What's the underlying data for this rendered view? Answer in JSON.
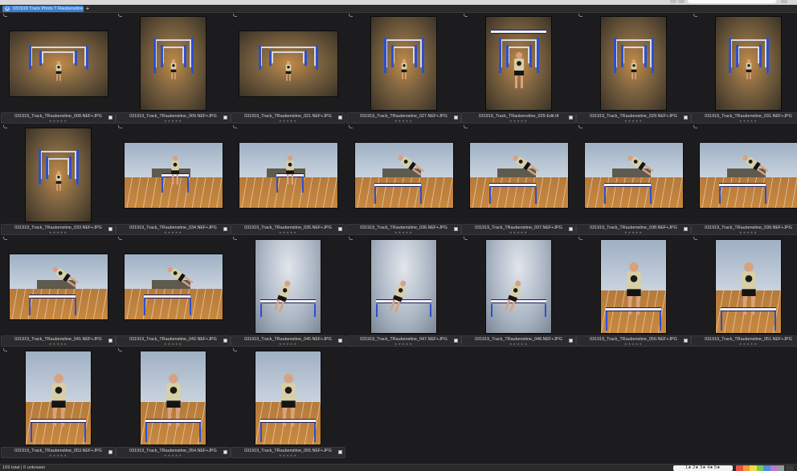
{
  "window": {
    "tab_title": "031919 Track Prints T Raubenstine",
    "tab_close_glyph": "×",
    "tab_add_glyph": "+"
  },
  "thumbnails": [
    {
      "filename": "031919_Track_TRaubenstine_008.NEF+JPG",
      "scene": "tunnel",
      "orientation": "landscape"
    },
    {
      "filename": "031919_Track_TRaubenstine_009.NEF+JPG",
      "scene": "tunnel",
      "orientation": "portrait"
    },
    {
      "filename": "031919_Track_TRaubenstine_021.NEF+JPG",
      "scene": "tunnel",
      "orientation": "landscape"
    },
    {
      "filename": "031919_Track_TRaubenstine_027.NEF+JPG",
      "scene": "tunnel",
      "orientation": "portrait"
    },
    {
      "filename": "031919_Track_TRaubenstine_029-Edit.tif",
      "scene": "tunnel-crouch",
      "orientation": "portrait"
    },
    {
      "filename": "031919_Track_TRaubenstine_029.NEF+JPG",
      "scene": "tunnel",
      "orientation": "portrait"
    },
    {
      "filename": "031919_Track_TRaubenstine_031.NEF+JPG",
      "scene": "tunnel",
      "orientation": "portrait"
    },
    {
      "filename": "031919_Track_TRaubenstine_033.NEF+JPG",
      "scene": "tunnel",
      "orientation": "portrait"
    },
    {
      "filename": "031919_Track_TRaubenstine_034.NEF+JPG",
      "scene": "stadium",
      "orientation": "landscape"
    },
    {
      "filename": "031919_Track_TRaubenstine_035.NEF+JPG",
      "scene": "stadium",
      "orientation": "landscape"
    },
    {
      "filename": "031919_Track_TRaubenstine_036.NEF+JPG",
      "scene": "stadium-jump",
      "orientation": "landscape"
    },
    {
      "filename": "031919_Track_TRaubenstine_037.NEF+JPG",
      "scene": "stadium-jump",
      "orientation": "landscape"
    },
    {
      "filename": "031919_Track_TRaubenstine_038.NEF+JPG",
      "scene": "stadium-jump",
      "orientation": "landscape"
    },
    {
      "filename": "031919_Track_TRaubenstine_039.NEF+JPG",
      "scene": "stadium-jump",
      "orientation": "landscape"
    },
    {
      "filename": "031919_Track_TRaubenstine_041.NEF+JPG",
      "scene": "stadium-jump",
      "orientation": "landscape"
    },
    {
      "filename": "031919_Track_TRaubenstine_042.NEF+JPG",
      "scene": "stadium-jump",
      "orientation": "landscape"
    },
    {
      "filename": "031919_Track_TRaubenstine_045.NEF+JPG",
      "scene": "sky",
      "orientation": "portrait"
    },
    {
      "filename": "031919_Track_TRaubenstine_047.NEF+JPG",
      "scene": "sky",
      "orientation": "portrait"
    },
    {
      "filename": "031919_Track_TRaubenstine_048.NEF+JPG",
      "scene": "sky",
      "orientation": "portrait"
    },
    {
      "filename": "031919_Track_TRaubenstine_050.NEF+JPG",
      "scene": "portrait",
      "orientation": "portrait"
    },
    {
      "filename": "031919_Track_TRaubenstine_051.NEF+JPG",
      "scene": "portrait",
      "orientation": "portrait"
    },
    {
      "filename": "031919_Track_TRaubenstine_053.NEF+JPG",
      "scene": "portrait",
      "orientation": "portrait"
    },
    {
      "filename": "031919_Track_TRaubenstine_054.NEF+JPG",
      "scene": "portrait",
      "orientation": "portrait"
    },
    {
      "filename": "031919_Track_TRaubenstine_055.NEF+JPG",
      "scene": "portrait",
      "orientation": "portrait"
    }
  ],
  "rating_placeholder": "★★★★★",
  "status": {
    "summary": "169 total | 0 unknown",
    "rating_filter": "1★ 2★ 3★ 4★ 5★"
  },
  "colors": {
    "background": "#1c1c1e",
    "accent_tab": "#3d7fcf",
    "hurdle_blue": "#2e4fcc",
    "track_orange": "#c8883f",
    "color_labels": [
      "#e8534a",
      "#f29a3a",
      "#f3d84a",
      "#6fcf5a",
      "#4f8fe0",
      "#b77ad6",
      "#9a9a9a"
    ]
  }
}
